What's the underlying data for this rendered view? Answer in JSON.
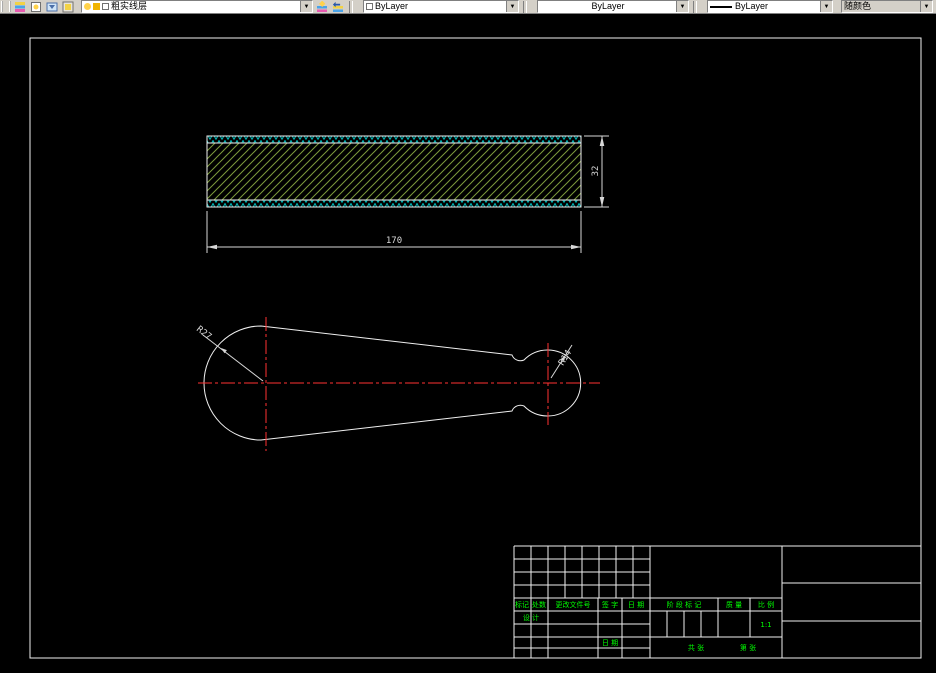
{
  "colors": {
    "toolbar_bg": "#d4d0c8",
    "canvas_bg": "#000000",
    "white": "#f0f0f0",
    "dim": "#d8d8d8",
    "red": "#ff3232",
    "green": "#00ff00",
    "hatch": "#7d9b3c",
    "cyan": "#00b8b8"
  },
  "toolbar": {
    "layer_value": "粗实线层",
    "color_value": "ByLayer",
    "linetype_value": "ByLayer",
    "lineweight_value": "ByLayer",
    "plot_style_label": "随颜色"
  },
  "drawing": {
    "dim_length": "170",
    "dim_height": "32",
    "radius_large": "R27",
    "radius_small": "R14"
  },
  "titleblock": {
    "mark": "标记",
    "count": "处数",
    "change_doc": "更改文件号",
    "sign": "签 字",
    "date": "日 期",
    "design": "设 计",
    "date_bottom": "日 期",
    "stage_mark": "阶 段 标 记",
    "mass": "质 量",
    "scale_label": "比 例",
    "scale_value": "1:1",
    "total_sheets": "共  张",
    "sheet_no": "第  张"
  }
}
